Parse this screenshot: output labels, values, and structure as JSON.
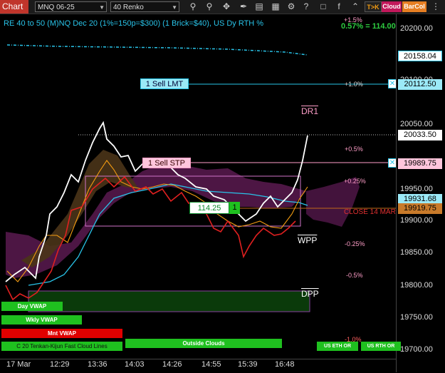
{
  "toolbar": {
    "tab_label": "Chart",
    "instrument": "MNQ 06-25",
    "bar_type": "40 Renko",
    "tk_label": "T>K",
    "cloud_label": "Cloud",
    "barcol_label": "BarCol"
  },
  "header": {
    "title": "RE 40 to 50 (M)NQ Dec 20 (1%=150p=$300) (1 Brick=$40), US Dy RTH %",
    "pct_readout": "0.57% = 114.00"
  },
  "price_axis": {
    "ticks": [
      "20200.00",
      "20150.00",
      "20100.00",
      "20050.00",
      "20000.00",
      "19950.00",
      "19900.00",
      "19850.00",
      "19800.00",
      "19750.00",
      "19700.00"
    ],
    "tags": {
      "cyan_top": "20158.04",
      "sell_lmt": "20112.50",
      "last": "20033.50",
      "sell_stp": "19989.75",
      "cyan_mid": "19931.68",
      "close_line": "19919.75"
    }
  },
  "pct_levels": {
    "p15": "+1.5%",
    "p10": "+1.0%",
    "p05": "+0.5%",
    "p025": "+0.25%",
    "m025": "-0.25%",
    "m05": "-0.5%",
    "m10": "-1.0%"
  },
  "levels": {
    "dr1": "DR1",
    "wpp": "WPP",
    "dpp": "DPP",
    "close_label": "CLOSE 14 MAR"
  },
  "orders": {
    "sell_lmt": "1 Sell LMT",
    "sell_stp": "1 Sell STP",
    "position_price": "114.25",
    "position_qty": "1"
  },
  "bottom_labels": {
    "day_vwap": "Day VWAP",
    "wkly_vwap": "Wkly VWAP",
    "mnt_vwap": "Mnt VWAP",
    "cloud_lines": "C 20 Tenkan-Kijun Fast Cloud Lines",
    "outside_clouds": "Outside Clouds",
    "us_eth": "US ETH OR",
    "us_rth": "US RTH OR"
  },
  "time_axis": [
    "17 Mar",
    "12:29",
    "13:36",
    "14:03",
    "14:26",
    "14:55",
    "15:39",
    "16:48"
  ],
  "colors": {
    "price_up": "#ffffff",
    "price_down": "#e02020",
    "cyan_line": "#29c3e8",
    "orange_line": "#f39c12",
    "cloud_purple": "#6b1f5e",
    "cloud_brown": "#4a3418",
    "green_bar": "#1fc01f",
    "red_bar": "#e00000"
  }
}
